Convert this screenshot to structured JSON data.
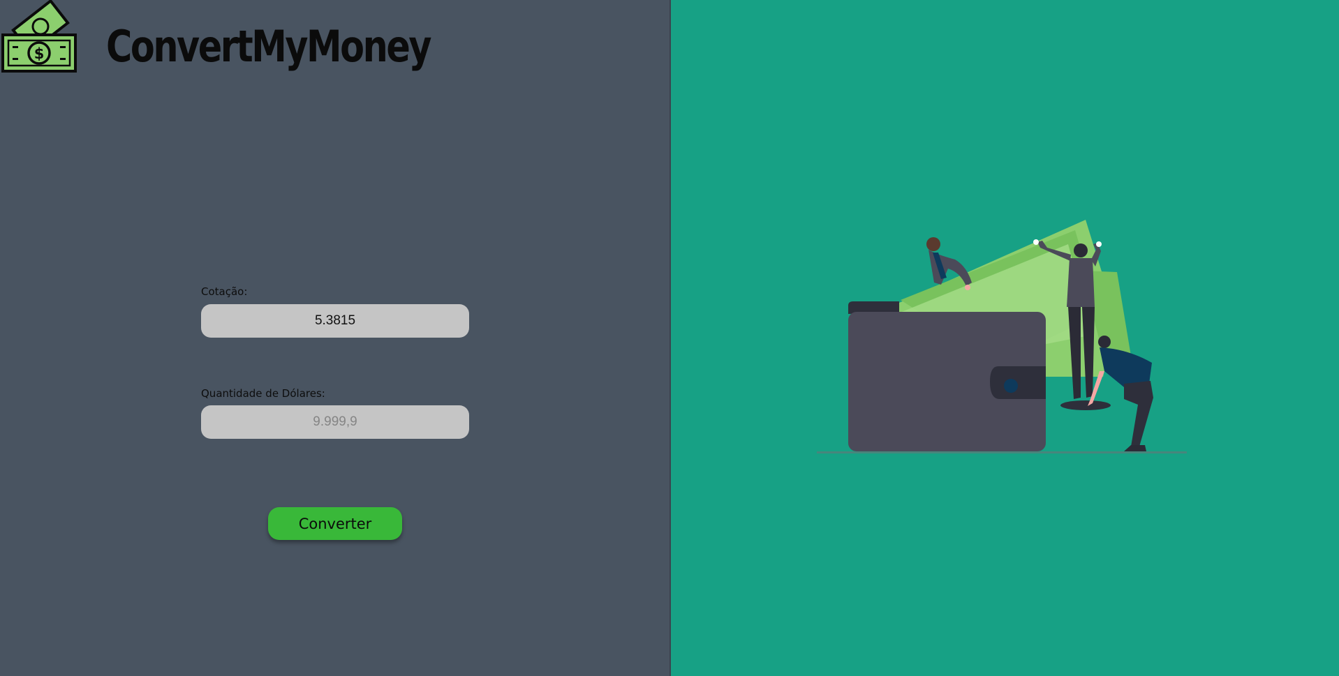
{
  "app": {
    "brand_name": "ConvertMyMoney",
    "logo_icon": "money-bills-dollar-icon"
  },
  "form": {
    "rate_label": "Cotação:",
    "rate_value": "5.3815",
    "amount_label": "Quantidade de Dólares:",
    "amount_placeholder": "9.999,9",
    "amount_value": "",
    "submit_label": "Converter"
  },
  "illustration": {
    "icon": "people-pulling-money-from-wallet-illustration"
  },
  "colors": {
    "left_panel": "#495461",
    "right_panel": "#17a185",
    "button": "#39b839",
    "input": "#c5c5c5",
    "money_green": "#8ccf6e"
  }
}
